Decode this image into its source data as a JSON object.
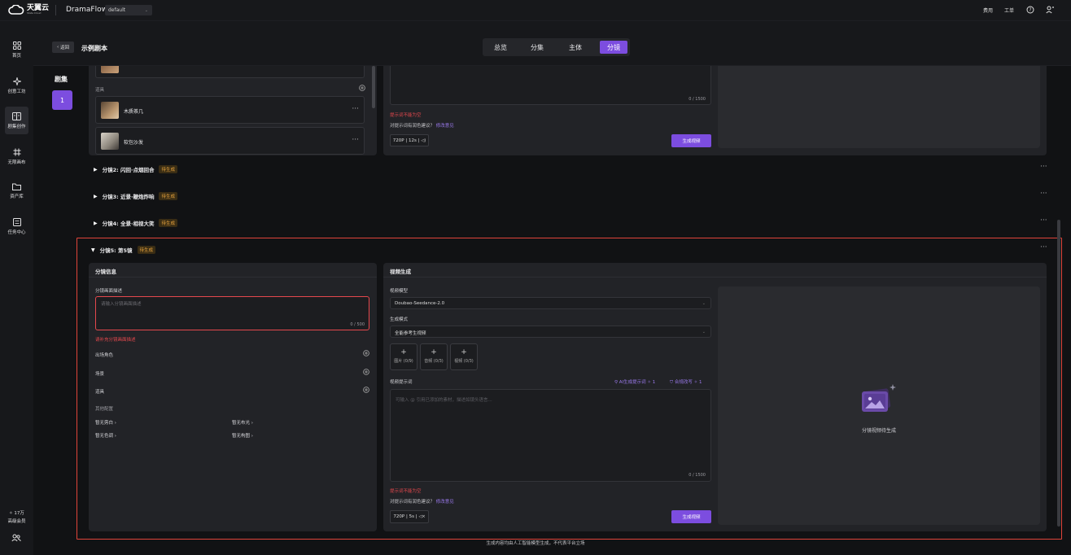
{
  "topbar": {
    "brand_name": "天翼云",
    "brand_sub": "State Cloud",
    "app_name": "DramaFlow",
    "workspace": "default",
    "right_links": [
      "费用",
      "工单"
    ]
  },
  "sidebar": {
    "items": [
      {
        "label": "首页",
        "icon": "grid-icon"
      },
      {
        "label": "创意工坊",
        "icon": "sparkle-icon"
      },
      {
        "label": "剧集创作",
        "icon": "book-icon"
      },
      {
        "label": "无限画布",
        "icon": "hash-icon"
      },
      {
        "label": "资产库",
        "icon": "folder-icon"
      },
      {
        "label": "任务中心",
        "icon": "tasklist-icon"
      }
    ],
    "credits": "17万",
    "membership": "高级会员"
  },
  "header": {
    "back_label": "返回",
    "title": "示例剧本",
    "tabs": [
      "总览",
      "分集",
      "主体",
      "分镜"
    ],
    "active_tab": "分镜"
  },
  "episodes": {
    "label": "剧集",
    "items": [
      "1"
    ]
  },
  "shot1": {
    "props_label": "道具",
    "props": [
      {
        "name": "木质茶几"
      },
      {
        "name": "软包沙发"
      }
    ],
    "prompt_counter": "0 / 1500",
    "prompt_error": "提示词不能为空",
    "suggest_q": "对提示词有润色建议？",
    "suggest_link": "修改意见",
    "settings_chip": "720P | 12s |",
    "generate_label": "生成视频"
  },
  "collapsed_shots": [
    {
      "title": "分镜2: 闪回·点烟回合",
      "status": "待生成"
    },
    {
      "title": "分镜3: 近景·鞭炮炸响",
      "status": "待生成"
    },
    {
      "title": "分镜4: 全景·相视大笑",
      "status": "待生成"
    }
  ],
  "shot5": {
    "title": "分镜5: 第5镜",
    "status": "待生成",
    "info_panel": {
      "header": "分镜信息",
      "desc_label": "分镜画面描述",
      "desc_placeholder": "请输入分镜画面描述",
      "desc_counter": "0 / 500",
      "desc_error": "请补充分镜画面描述",
      "characters_label": "出场角色",
      "scene_label": "场景",
      "props_label": "道具",
      "other_label": "其他配置",
      "configs": [
        "暂无旁白",
        "暂无布光",
        "暂无色调",
        "暂无构图"
      ]
    },
    "video_panel": {
      "header": "视频生成",
      "model_label": "视频模型",
      "model_value": "Doubao-Seedance-2.0",
      "mode_label": "生成模式",
      "mode_value": "全能参考生视频",
      "uploads": [
        "图片 (0/9)",
        "音频 (0/3)",
        "视频 (0/3)"
      ],
      "prompt_label": "视频提示词",
      "ai_prompt_label": "AI生成提示词",
      "ai_prompt_cost": "1",
      "compliance_label": "合规改写",
      "compliance_cost": "1",
      "prompt_placeholder": "可输入 @ 引用已添加的素材，描述如镜头语言...",
      "prompt_counter": "0 / 1500",
      "prompt_error": "提示词不能为空",
      "suggest_q": "对提示词有润色建议？",
      "suggest_link": "修改意见",
      "settings_chip": "720P | 5s |",
      "generate_label": "生成视频",
      "preview_text": "分镜视频待生成"
    }
  },
  "footer": "生成内容均由人工智能模型生成，不代表平台立场",
  "colors": {
    "accent": "#7c4ddf",
    "error": "#e5484d",
    "warning": "#e7a33e",
    "highlight_border": "#e0443a"
  }
}
